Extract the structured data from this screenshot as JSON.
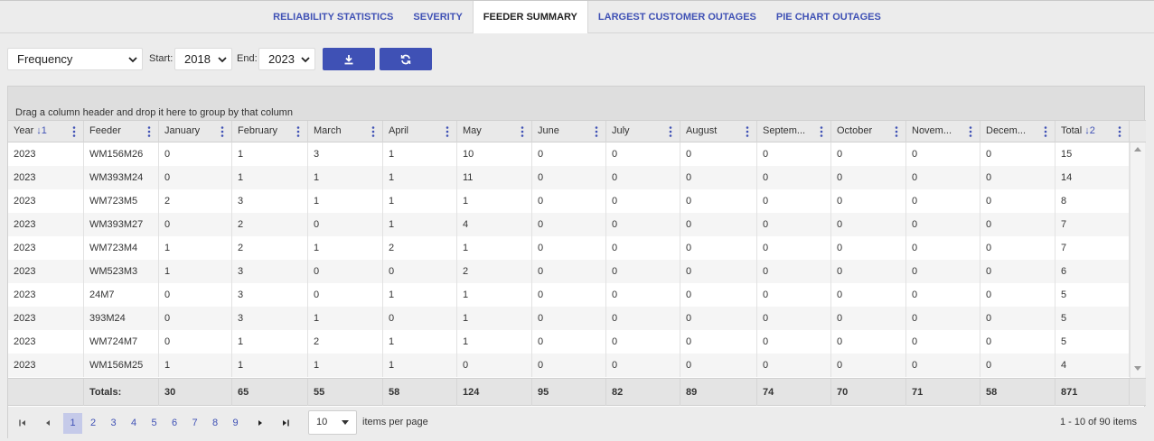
{
  "tabs": [
    {
      "label": "RELIABILITY STATISTICS",
      "active": false
    },
    {
      "label": "SEVERITY",
      "active": false
    },
    {
      "label": "FEEDER SUMMARY",
      "active": true
    },
    {
      "label": "LARGEST CUSTOMER OUTAGES",
      "active": false
    },
    {
      "label": "PIE CHART OUTAGES",
      "active": false
    }
  ],
  "toolbar": {
    "metric": "Frequency",
    "start_label": "Start:",
    "start_value": "2018",
    "end_label": "End:",
    "end_value": "2023",
    "download_icon": "download-icon",
    "refresh_icon": "refresh-icon",
    "accent": "#3f51b5"
  },
  "grid": {
    "group_hint": "Drag a column header and drop it here to group by that column",
    "columns": [
      {
        "label": "Year",
        "sort": "↓1"
      },
      {
        "label": "Feeder",
        "sort": ""
      },
      {
        "label": "January",
        "sort": ""
      },
      {
        "label": "February",
        "sort": ""
      },
      {
        "label": "March",
        "sort": ""
      },
      {
        "label": "April",
        "sort": ""
      },
      {
        "label": "May",
        "sort": ""
      },
      {
        "label": "June",
        "sort": ""
      },
      {
        "label": "July",
        "sort": ""
      },
      {
        "label": "August",
        "sort": ""
      },
      {
        "label": "Septem...",
        "sort": ""
      },
      {
        "label": "October",
        "sort": ""
      },
      {
        "label": "Novem...",
        "sort": ""
      },
      {
        "label": "Decem...",
        "sort": ""
      },
      {
        "label": "Total",
        "sort": "↓2"
      }
    ],
    "rows": [
      [
        "2023",
        "WM156M26",
        "0",
        "1",
        "3",
        "1",
        "10",
        "0",
        "0",
        "0",
        "0",
        "0",
        "0",
        "0",
        "15"
      ],
      [
        "2023",
        "WM393M24",
        "0",
        "1",
        "1",
        "1",
        "11",
        "0",
        "0",
        "0",
        "0",
        "0",
        "0",
        "0",
        "14"
      ],
      [
        "2023",
        "WM723M5",
        "2",
        "3",
        "1",
        "1",
        "1",
        "0",
        "0",
        "0",
        "0",
        "0",
        "0",
        "0",
        "8"
      ],
      [
        "2023",
        "WM393M27",
        "0",
        "2",
        "0",
        "1",
        "4",
        "0",
        "0",
        "0",
        "0",
        "0",
        "0",
        "0",
        "7"
      ],
      [
        "2023",
        "WM723M4",
        "1",
        "2",
        "1",
        "2",
        "1",
        "0",
        "0",
        "0",
        "0",
        "0",
        "0",
        "0",
        "7"
      ],
      [
        "2023",
        "WM523M3",
        "1",
        "3",
        "0",
        "0",
        "2",
        "0",
        "0",
        "0",
        "0",
        "0",
        "0",
        "0",
        "6"
      ],
      [
        "2023",
        "24M7",
        "0",
        "3",
        "0",
        "1",
        "1",
        "0",
        "0",
        "0",
        "0",
        "0",
        "0",
        "0",
        "5"
      ],
      [
        "2023",
        "393M24",
        "0",
        "3",
        "1",
        "0",
        "1",
        "0",
        "0",
        "0",
        "0",
        "0",
        "0",
        "0",
        "5"
      ],
      [
        "2023",
        "WM724M7",
        "0",
        "1",
        "2",
        "1",
        "1",
        "0",
        "0",
        "0",
        "0",
        "0",
        "0",
        "0",
        "5"
      ],
      [
        "2023",
        "WM156M25",
        "1",
        "1",
        "1",
        "1",
        "0",
        "0",
        "0",
        "0",
        "0",
        "0",
        "0",
        "0",
        "4"
      ]
    ],
    "totals": [
      "",
      "Totals:",
      "30",
      "65",
      "55",
      "58",
      "124",
      "95",
      "82",
      "89",
      "74",
      "70",
      "71",
      "58",
      "871"
    ]
  },
  "pager": {
    "pages": [
      "1",
      "2",
      "3",
      "4",
      "5",
      "6",
      "7",
      "8",
      "9"
    ],
    "active_page": "1",
    "page_size": "10",
    "page_size_label": "items per page",
    "info": "1 - 10 of 90 items"
  }
}
